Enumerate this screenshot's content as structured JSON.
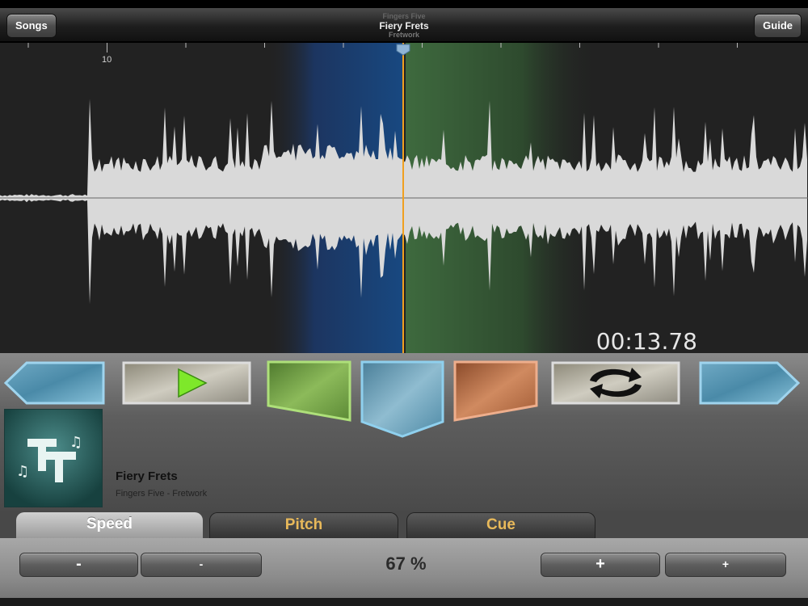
{
  "topbar": {
    "songs_label": "Songs",
    "guide_label": "Guide",
    "artist": "Fingers Five",
    "song": "Fiery Frets",
    "album": "Fretwork"
  },
  "waveform": {
    "marker_label": "10",
    "time": "00:13.78",
    "colors": {
      "loop_start": "#1c3f6a",
      "loop_end": "#3a5a3a",
      "playhead": "#f0a020",
      "wave": "#d9d9d9"
    }
  },
  "track": {
    "title": "Fiery Frets",
    "subtitle": "Fingers Five - Fretwork"
  },
  "tabs": {
    "speed": "Speed",
    "pitch": "Pitch",
    "cue": "Cue"
  },
  "speed_panel": {
    "minus_large": "-",
    "minus_small": "-",
    "value": "67 %",
    "plus_large": "+",
    "plus_small": "+"
  }
}
